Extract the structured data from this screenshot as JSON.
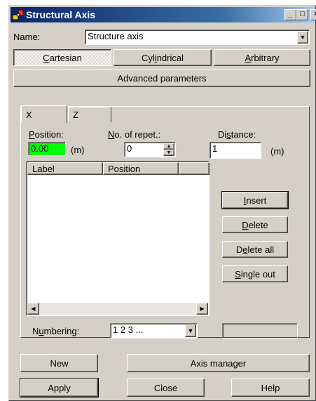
{
  "window": {
    "title": "Structural Axis"
  },
  "name_row": {
    "label": "Name:",
    "value": "Structure axis"
  },
  "type_buttons": {
    "cartesian": {
      "pre": "",
      "ul": "C",
      "post": "artesian"
    },
    "cylindrical": {
      "pre": "Cyl",
      "ul": "i",
      "post": "ndrical"
    },
    "arbitrary": {
      "pre": "",
      "ul": "A",
      "post": "rbitrary"
    }
  },
  "advanced_label": "Advanced parameters",
  "tabs": {
    "x": "X",
    "z": "Z"
  },
  "position": {
    "label_ul": "P",
    "label_rest": "osition:",
    "value": "0.00",
    "unit": "(m)",
    "highlight": "#00ff00"
  },
  "repetitions": {
    "label_ul": "N",
    "label_rest": "o. of repet.:",
    "value": "0"
  },
  "distance": {
    "label_pre": "Di",
    "label_ul": "s",
    "label_rest": "tance:",
    "value": "1",
    "unit": "(m)"
  },
  "list": {
    "col_label": "Label",
    "col_position": "Position"
  },
  "actions": {
    "insert": {
      "pre": "",
      "ul": "I",
      "post": "nsert"
    },
    "delete": {
      "pre": "",
      "ul": "D",
      "post": "elete"
    },
    "delete_all": {
      "pre": "D",
      "ul": "e",
      "post": "lete all"
    },
    "single_out": {
      "pre": "",
      "ul": "S",
      "post": "ingle out"
    }
  },
  "numbering": {
    "label_pre": "N",
    "label_ul": "u",
    "label_rest": "mbering:",
    "value": "1 2 3 ..."
  },
  "bottom": {
    "new": "New",
    "axis_manager": "Axis manager",
    "apply": "Apply",
    "close": "Close",
    "help": "Help"
  }
}
